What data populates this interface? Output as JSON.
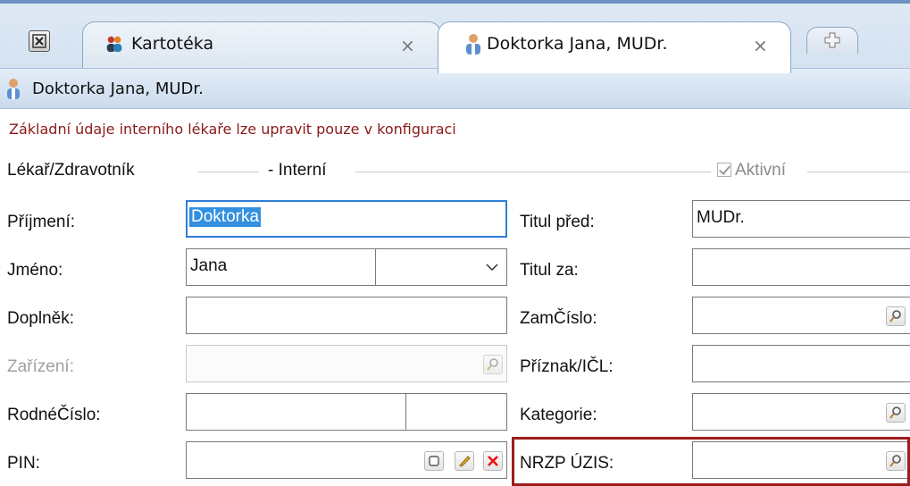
{
  "tabs": [
    {
      "label": "Kartotéka",
      "close": "×"
    },
    {
      "label": "Doktorka Jana, MUDr.",
      "close": "×"
    }
  ],
  "header": {
    "title": "Doktorka Jana, MUDr."
  },
  "warning": "Základní údaje interního lékaře lze upravit pouze v konfiguraci",
  "group": {
    "title": "Lékař/Zdravotník",
    "subtitle": "- Interní",
    "active_label": "Aktivní"
  },
  "left": {
    "prijmeni_label": "Příjmení:",
    "prijmeni_value": "Doktorka",
    "jmeno_label": "Jméno:",
    "jmeno_value": "Jana",
    "doplnek_label": "Doplněk:",
    "doplnek_value": "",
    "zarizeni_label": "Zařízení:",
    "zarizeni_value": "",
    "rodne_label": "RodnéČíslo:",
    "rodne_value": "",
    "pin_label": "PIN:",
    "pin_value": ""
  },
  "right": {
    "titul_pred_label": "Titul před:",
    "titul_pred_value": "MUDr.",
    "titul_za_label": "Titul za:",
    "titul_za_value": "",
    "zamcislo_label": "ZamČíslo:",
    "zamcislo_value": "",
    "priznak_label": "Příznak/IČL:",
    "priznak_value": "",
    "kategorie_label": "Kategorie:",
    "kategorie_value": "",
    "nrzp_label": "NRZP ÚZIS:",
    "nrzp_value": ""
  },
  "colors": {
    "highlight": "#a01c1c",
    "focus": "#2f7fd6",
    "warning": "#8b1a1a"
  }
}
